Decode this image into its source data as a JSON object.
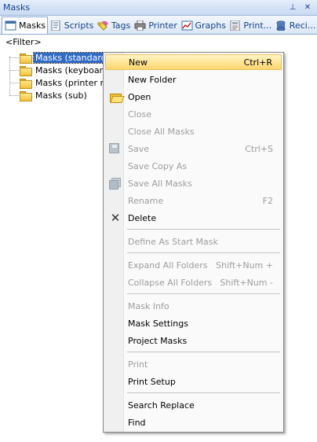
{
  "panel": {
    "title": "Masks",
    "pin_glyph": "⊥",
    "close_glyph": "✕"
  },
  "tabs": [
    {
      "label": "Masks",
      "icon": "mask-icon",
      "active": true
    },
    {
      "label": "Scripts",
      "icon": "script-icon",
      "active": false
    },
    {
      "label": "Tags",
      "icon": "tags-icon",
      "active": false
    },
    {
      "label": "Printer",
      "icon": "printer-icon",
      "active": false
    },
    {
      "label": "Graphs",
      "icon": "graph-icon",
      "active": false
    },
    {
      "label": "Print...",
      "icon": "print-template-icon",
      "active": false
    },
    {
      "label": "Reci...",
      "icon": "recipe-icon",
      "active": false
    }
  ],
  "filter": "<Filter>",
  "tree": {
    "items": [
      {
        "label": "Masks (standard)",
        "selected": true
      },
      {
        "label": "Masks (keyboard)",
        "selected": false
      },
      {
        "label": "Masks (printer repo",
        "selected": false
      },
      {
        "label": "Masks (sub)",
        "selected": false
      }
    ]
  },
  "menu": {
    "items": [
      {
        "label": "New",
        "shortcut": "Ctrl+R",
        "disabled": false,
        "icon": ""
      },
      {
        "label": "New Folder",
        "shortcut": "",
        "disabled": false,
        "icon": ""
      },
      {
        "label": "Open",
        "shortcut": "",
        "disabled": false,
        "icon": "open-folder-icon"
      },
      {
        "label": "Close",
        "shortcut": "",
        "disabled": true,
        "icon": ""
      },
      {
        "label": "Close All Masks",
        "shortcut": "",
        "disabled": true,
        "icon": ""
      },
      {
        "label": "Save",
        "shortcut": "Ctrl+S",
        "disabled": true,
        "icon": "save-icon"
      },
      {
        "label": "Save Copy As",
        "shortcut": "",
        "disabled": true,
        "icon": ""
      },
      {
        "label": "Save All Masks",
        "shortcut": "",
        "disabled": true,
        "icon": "save-all-icon"
      },
      {
        "label": "Rename",
        "shortcut": "F2",
        "disabled": true,
        "icon": ""
      },
      {
        "label": "Delete",
        "shortcut": "",
        "disabled": false,
        "icon": "delete-icon"
      },
      {
        "label": "Define As Start Mask",
        "shortcut": "",
        "disabled": true,
        "icon": ""
      },
      {
        "label": "Expand All Folders",
        "shortcut": "Shift+Num +",
        "disabled": true,
        "icon": ""
      },
      {
        "label": "Collapse All Folders",
        "shortcut": "Shift+Num -",
        "disabled": true,
        "icon": ""
      },
      {
        "label": "Mask Info",
        "shortcut": "",
        "disabled": true,
        "icon": ""
      },
      {
        "label": "Mask Settings",
        "shortcut": "",
        "disabled": false,
        "icon": ""
      },
      {
        "label": "Project Masks",
        "shortcut": "",
        "disabled": false,
        "icon": ""
      },
      {
        "label": "Print",
        "shortcut": "",
        "disabled": true,
        "icon": ""
      },
      {
        "label": "Print Setup",
        "shortcut": "",
        "disabled": false,
        "icon": ""
      },
      {
        "label": "Search Replace",
        "shortcut": "",
        "disabled": false,
        "icon": ""
      },
      {
        "label": "Find",
        "shortcut": "",
        "disabled": false,
        "icon": ""
      }
    ]
  },
  "colors": {
    "title_text": "#15428b",
    "selection": "#316ac5",
    "menu_hover": "#ffd66e",
    "disabled_text": "#9d9d9d"
  }
}
